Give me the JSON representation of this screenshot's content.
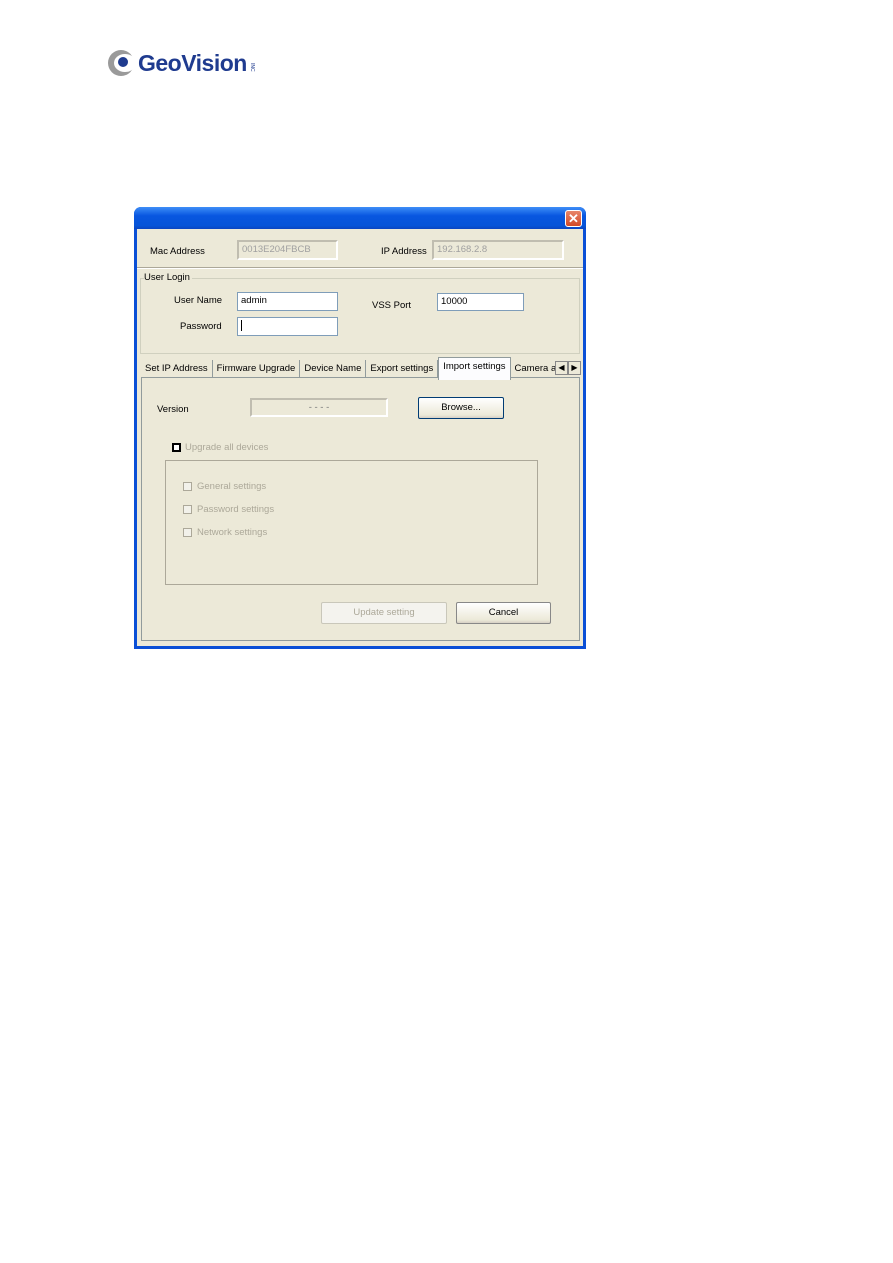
{
  "logo": {
    "brand": "GeoVision",
    "sub": "INC"
  },
  "dialog": {
    "close_icon": "close-icon",
    "mac_label": "Mac Address",
    "mac_value": "0013E204FBCB",
    "ip_label": "IP Address",
    "ip_value": "192.168.2.8",
    "user_login_label": "User Login",
    "username_label": "User Name",
    "username_value": "admin",
    "password_label": "Password",
    "password_value": "",
    "vss_port_label": "VSS Port",
    "vss_port_value": "10000",
    "tabs": [
      {
        "label": "Set IP Address"
      },
      {
        "label": "Firmware Upgrade"
      },
      {
        "label": "Device Name"
      },
      {
        "label": "Export settings"
      },
      {
        "label": "Import settings",
        "active": true
      },
      {
        "label": "Camera a"
      }
    ],
    "import": {
      "version_label": "Version",
      "version_value": "- - - -",
      "browse_label": "Browse...",
      "upgrade_all_label": "Upgrade all devices",
      "options": [
        {
          "label": "General settings",
          "checked": false
        },
        {
          "label": "Password settings",
          "checked": false
        },
        {
          "label": "Network settings",
          "checked": false
        }
      ],
      "update_label": "Update setting",
      "cancel_label": "Cancel"
    }
  }
}
